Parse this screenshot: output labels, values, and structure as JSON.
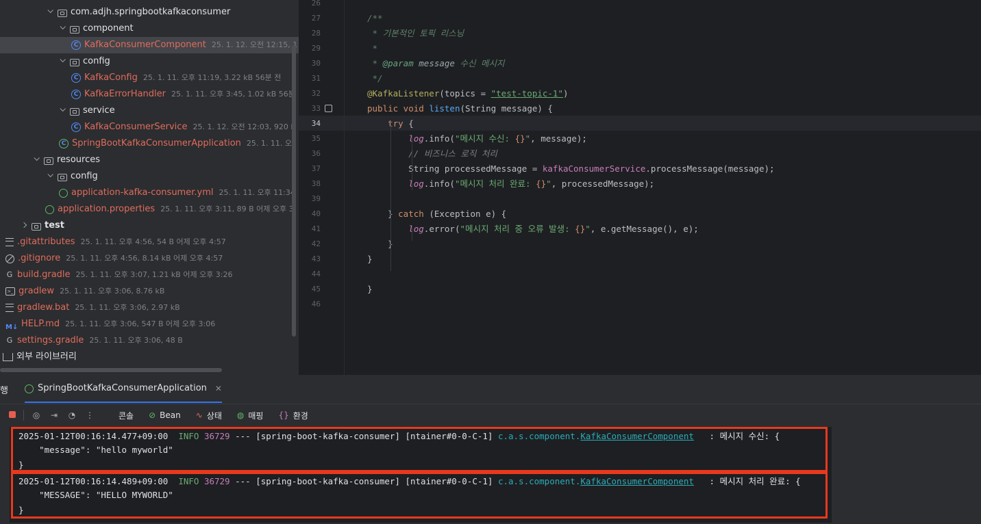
{
  "tree": {
    "rows": [
      {
        "name": "com.adjh.springbootkafkaconsumer",
        "meta": "",
        "chev": "down",
        "icon": "folder-icon",
        "kind": "folder"
      },
      {
        "name": "component",
        "meta": "",
        "chev": "down",
        "icon": "folder-icon",
        "kind": "folder"
      },
      {
        "name": "KafkaConsumerComponent",
        "meta": "25. 1. 12. 오전 12:15, 1",
        "chev": "",
        "icon": "class-icon",
        "kind": "red"
      },
      {
        "name": "config",
        "meta": "",
        "chev": "down",
        "icon": "folder-icon",
        "kind": "folder"
      },
      {
        "name": "KafkaConfig",
        "meta": "25. 1. 11. 오후 11:19, 3.22 kB 56분 전",
        "chev": "",
        "icon": "class-icon",
        "kind": "red"
      },
      {
        "name": "KafkaErrorHandler",
        "meta": "25. 1. 11. 오후 3:45, 1.02 kB 56분",
        "chev": "",
        "icon": "class-icon",
        "kind": "red"
      },
      {
        "name": "service",
        "meta": "",
        "chev": "down",
        "icon": "folder-icon",
        "kind": "folder"
      },
      {
        "name": "KafkaConsumerService",
        "meta": "25. 1. 12. 오전 12:03, 920 B",
        "chev": "",
        "icon": "class-icon",
        "kind": "red"
      },
      {
        "name": "SpringBootKafkaConsumerApplication",
        "meta": "25. 1. 11. 오",
        "chev": "",
        "icon": "spring-class-icon",
        "kind": "red"
      },
      {
        "name": "resources",
        "meta": "",
        "chev": "down",
        "icon": "resources-folder-icon",
        "kind": "folder"
      },
      {
        "name": "config",
        "meta": "",
        "chev": "down",
        "icon": "folder-icon",
        "kind": "folder"
      },
      {
        "name": "application-kafka-consumer.yml",
        "meta": "25. 1. 11. 오후 11:34",
        "chev": "",
        "icon": "spring-config-icon",
        "kind": "red"
      },
      {
        "name": "application.properties",
        "meta": "25. 1. 11. 오후 3:11, 89 B 어제 오후 3:",
        "chev": "",
        "icon": "spring-config-icon",
        "kind": "red"
      },
      {
        "name": "test",
        "meta": "",
        "chev": "right",
        "icon": "folder-icon",
        "kind": "bold"
      },
      {
        "name": ".gitattributes",
        "meta": "25. 1. 11. 오후 4:56, 54 B 어제 오후 4:57",
        "chev": "",
        "icon": "text-file-icon",
        "kind": "red"
      },
      {
        "name": ".gitignore",
        "meta": "25. 1. 11. 오후 4:56, 8.14 kB 어제 오후 4:57",
        "chev": "",
        "icon": "ignore-file-icon",
        "kind": "red"
      },
      {
        "name": "build.gradle",
        "meta": "25. 1. 11. 오후 3:07, 1.21 kB 어제 오후 3:26",
        "chev": "",
        "icon": "gradle-icon",
        "kind": "red"
      },
      {
        "name": "gradlew",
        "meta": "25. 1. 11. 오후 3:06, 8.76 kB",
        "chev": "",
        "icon": "terminal-file-icon",
        "kind": "red"
      },
      {
        "name": "gradlew.bat",
        "meta": "25. 1. 11. 오후 3:06, 2.97 kB",
        "chev": "",
        "icon": "text-file-icon",
        "kind": "red"
      },
      {
        "name": "HELP.md",
        "meta": "25. 1. 11. 오후 3:06, 547 B 어제 오후 3:06",
        "chev": "",
        "icon": "markdown-icon",
        "kind": "red"
      },
      {
        "name": "settings.gradle",
        "meta": "25. 1. 11. 오후 3:06, 48 B",
        "chev": "",
        "icon": "gradle-icon",
        "kind": "red"
      },
      {
        "name": "외부 라이브러리",
        "meta": "",
        "chev": "",
        "icon": "library-icon",
        "kind": "plain"
      }
    ]
  },
  "editor": {
    "current_line": "34",
    "lines": [
      {
        "n": "26",
        "html": ""
      },
      {
        "n": "27",
        "html": "<span class='c-doc'>/**</span>"
      },
      {
        "n": "28",
        "html": "<span class='c-doc'> * 기본적인 토픽 리스닝</span>"
      },
      {
        "n": "29",
        "html": "<span class='c-doc'> *</span>"
      },
      {
        "n": "30",
        "html": "<span class='c-doc'> * </span><span class='c-tag'>@param</span><span class='c-doc'> </span><span class='c-doc' style='color:#9aa7b0'>message</span><span class='c-doc'> 수신 메시지</span>"
      },
      {
        "n": "31",
        "html": "<span class='c-doc'> */</span>"
      },
      {
        "n": "32",
        "html": "<span class='c-ann'>@KafkaListener</span>(topics = <span class='c-strl'>\"test-topic-1\"</span>)"
      },
      {
        "n": "33",
        "html": "<span class='c-kw'>public void</span> <span class='c-fn'>listen</span>(String message) {"
      },
      {
        "n": "34",
        "html": "    <span class='c-kw'>try</span> {"
      },
      {
        "n": "35",
        "html": "        <span class='c-log'>log</span>.info(<span class='c-str'>\"메시지 수신: </span><span class='c-br'>{}</span><span class='c-str'>\"</span>, message);"
      },
      {
        "n": "36",
        "html": "        <span class='c-com'>// 비즈니스 로직 처리</span>"
      },
      {
        "n": "37",
        "html": "        String processedMessage = <span class='c-fld'>kafkaConsumerService</span>.processMessage(message);"
      },
      {
        "n": "38",
        "html": "        <span class='c-log'>log</span>.info(<span class='c-str'>\"메시지 처리 완료: </span><span class='c-br'>{}</span><span class='c-str'>\"</span>, processedMessage);"
      },
      {
        "n": "39",
        "html": ""
      },
      {
        "n": "40",
        "html": "    } <span class='c-kw'>catch</span> (Exception e) {"
      },
      {
        "n": "41",
        "html": "        <span class='c-log'>log</span>.error(<span class='c-str'>\"메시지 처리 중 오류 발생: </span><span class='c-br'>{}</span><span class='c-str'>\"</span>, e.getMessage(), e);"
      },
      {
        "n": "42",
        "html": "    }"
      },
      {
        "n": "43",
        "html": "}"
      },
      {
        "n": "44",
        "html": ""
      },
      {
        "n": "45",
        "html": "}"
      },
      {
        "n": "46",
        "html": ""
      }
    ]
  },
  "run": {
    "panel_label_cut": "행",
    "tab_label": "SpringBootKafkaConsumerApplication",
    "tab_close": "✕",
    "toolbar": {
      "console": "콘솔",
      "bean": "Bean",
      "status": "상태",
      "mapping": "매핑",
      "env": "환경"
    },
    "logs": [
      {
        "timestamp": "2025-01-12T00:16:14.477+09:00",
        "level": "INFO",
        "pid": "36729",
        "sep": "---",
        "app": "[spring-boot-kafka-consumer]",
        "thread": "[ntainer#0-0-C-1]",
        "logger_pkg": "c.a.s.component.",
        "logger_cls": "KafkaConsumerComponent",
        "message": ": 메시지 수신: {",
        "body": "    \"message\": \"hello myworld\"",
        "close": "}"
      },
      {
        "timestamp": "2025-01-12T00:16:14.489+09:00",
        "level": "INFO",
        "pid": "36729",
        "sep": "---",
        "app": "[spring-boot-kafka-consumer]",
        "thread": "[ntainer#0-0-C-1]",
        "logger_pkg": "c.a.s.component.",
        "logger_cls": "KafkaConsumerComponent",
        "message": ": 메시지 처리 완료: {",
        "body": "    \"MESSAGE\": \"HELLO MYWORLD\"",
        "close": "}"
      }
    ]
  },
  "colors": {
    "highlight_border": "#e8391d",
    "accent": "#3574f0"
  }
}
